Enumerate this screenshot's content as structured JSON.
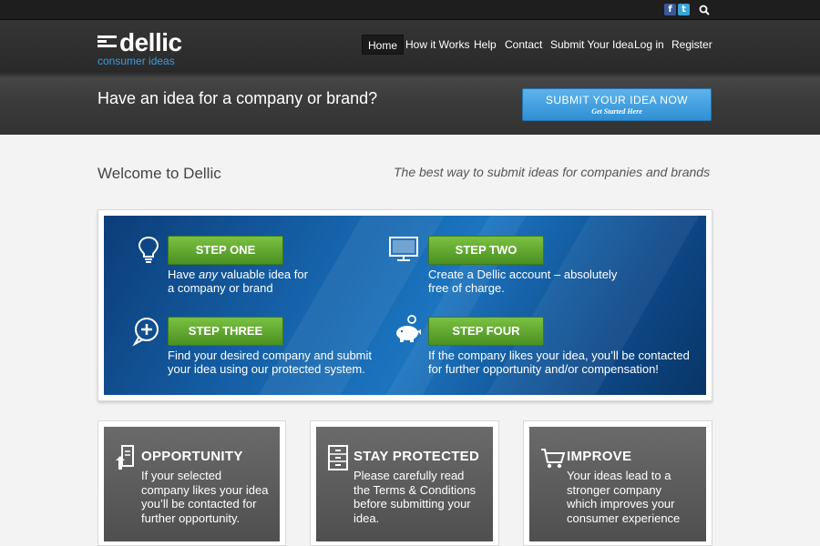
{
  "social": {
    "facebook": "f",
    "twitter": "t"
  },
  "logo": {
    "name": "dellic",
    "tagline": "consumer ideas"
  },
  "nav": [
    {
      "label": "Home"
    },
    {
      "label": "How it Works"
    },
    {
      "label": "Help"
    },
    {
      "label": "Contact"
    },
    {
      "label": "Submit Your Idea"
    },
    {
      "label": "Log in"
    },
    {
      "label": "Register"
    }
  ],
  "banner": {
    "headline": "Have an idea for a company or brand?",
    "cta_label": "SUBMIT YOUR IDEA NOW",
    "cta_sub": "Get Started Here"
  },
  "welcome": {
    "title": "Welcome to Dellic",
    "tagline": "The best way to submit ideas for companies and brands"
  },
  "steps": [
    {
      "label": "STEP ONE",
      "line1_pre": "Have ",
      "line1_em": "any",
      "line1_post": " valuable idea for",
      "line2": "a company or brand"
    },
    {
      "label": "STEP TWO",
      "line1": "Create a Dellic account – absolutely",
      "line2": "free of charge."
    },
    {
      "label": "STEP THREE",
      "line1": "Find your desired company and submit",
      "line2": "your idea using our protected system."
    },
    {
      "label": "STEP FOUR",
      "line1": "If the company likes your idea, you’ll be contacted",
      "line2": "for further opportunity and/or compensation!"
    }
  ],
  "cards": [
    {
      "title": "OPPORTUNITY",
      "lines": [
        "If your selected",
        "company likes your idea",
        "you’ll be contacted for",
        "further opportunity."
      ]
    },
    {
      "title": "STAY PROTECTED",
      "lines": [
        "Please carefully read",
        "the Terms & Conditions",
        "before submitting your",
        "idea."
      ]
    },
    {
      "title": "IMPROVE",
      "lines": [
        "Your ideas lead to a",
        "stronger company",
        "which improves your",
        "consumer experience"
      ]
    }
  ],
  "icons": {
    "step_one": "lightbulb-icon",
    "step_two": "monitor-icon",
    "step_three": "speech-plus-icon",
    "step_four": "piggy-bank-icon",
    "opportunity": "document-arrow-icon",
    "stay_protected": "filing-cabinet-icon",
    "improve": "shopping-cart-icon"
  },
  "colors": {
    "brand_blue": "#3b9be0",
    "step_green": "#5fa832",
    "cta_blue": "#3a9ee0"
  }
}
